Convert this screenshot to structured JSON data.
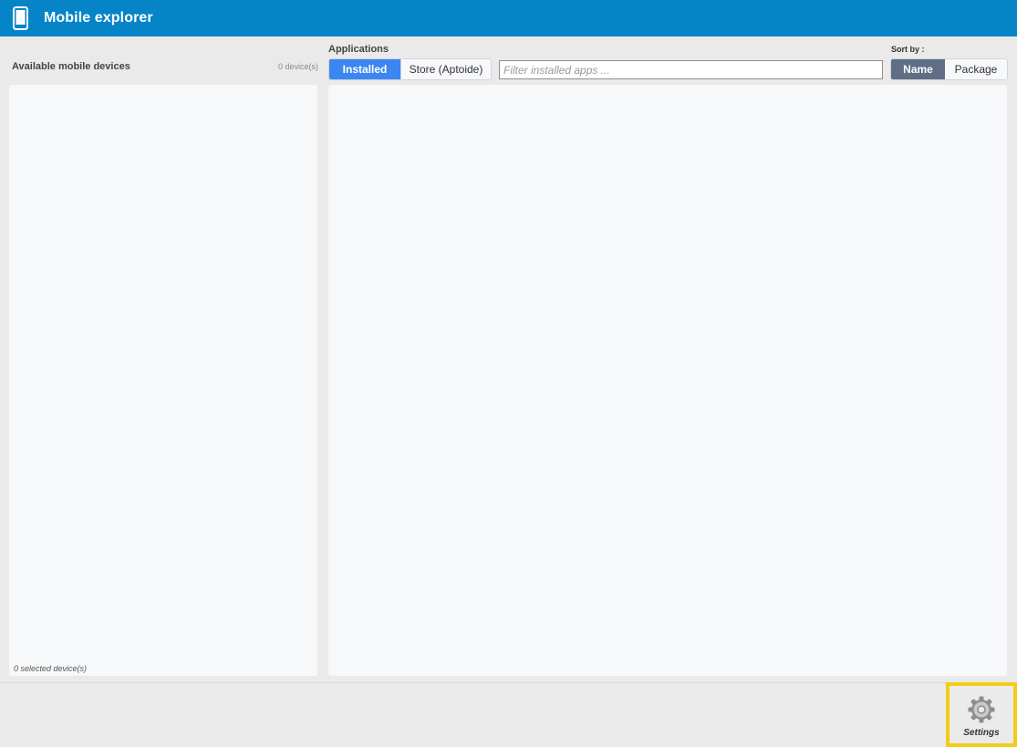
{
  "window": {
    "title": "Mobile explorer",
    "icon": "phone-icon"
  },
  "devices": {
    "heading": "Available mobile devices",
    "count": "0 device(s)",
    "selected": "0 selected device(s)"
  },
  "applications": {
    "heading": "Applications",
    "tabs": {
      "installed": "Installed",
      "store": "Store (Aptoide)"
    },
    "filter_placeholder": "Filter installed apps ...",
    "filter_value": ""
  },
  "sort": {
    "label": "Sort by :",
    "name": "Name",
    "package": "Package",
    "selected": "Name"
  },
  "footer": {
    "settings_label": "Settings",
    "settings_icon": "gear-icon"
  },
  "colors": {
    "titlebar": "#0684c8",
    "tab_active": "#3b86f0",
    "sort_active": "#5f6e84",
    "highlight": "#f4cc16"
  }
}
